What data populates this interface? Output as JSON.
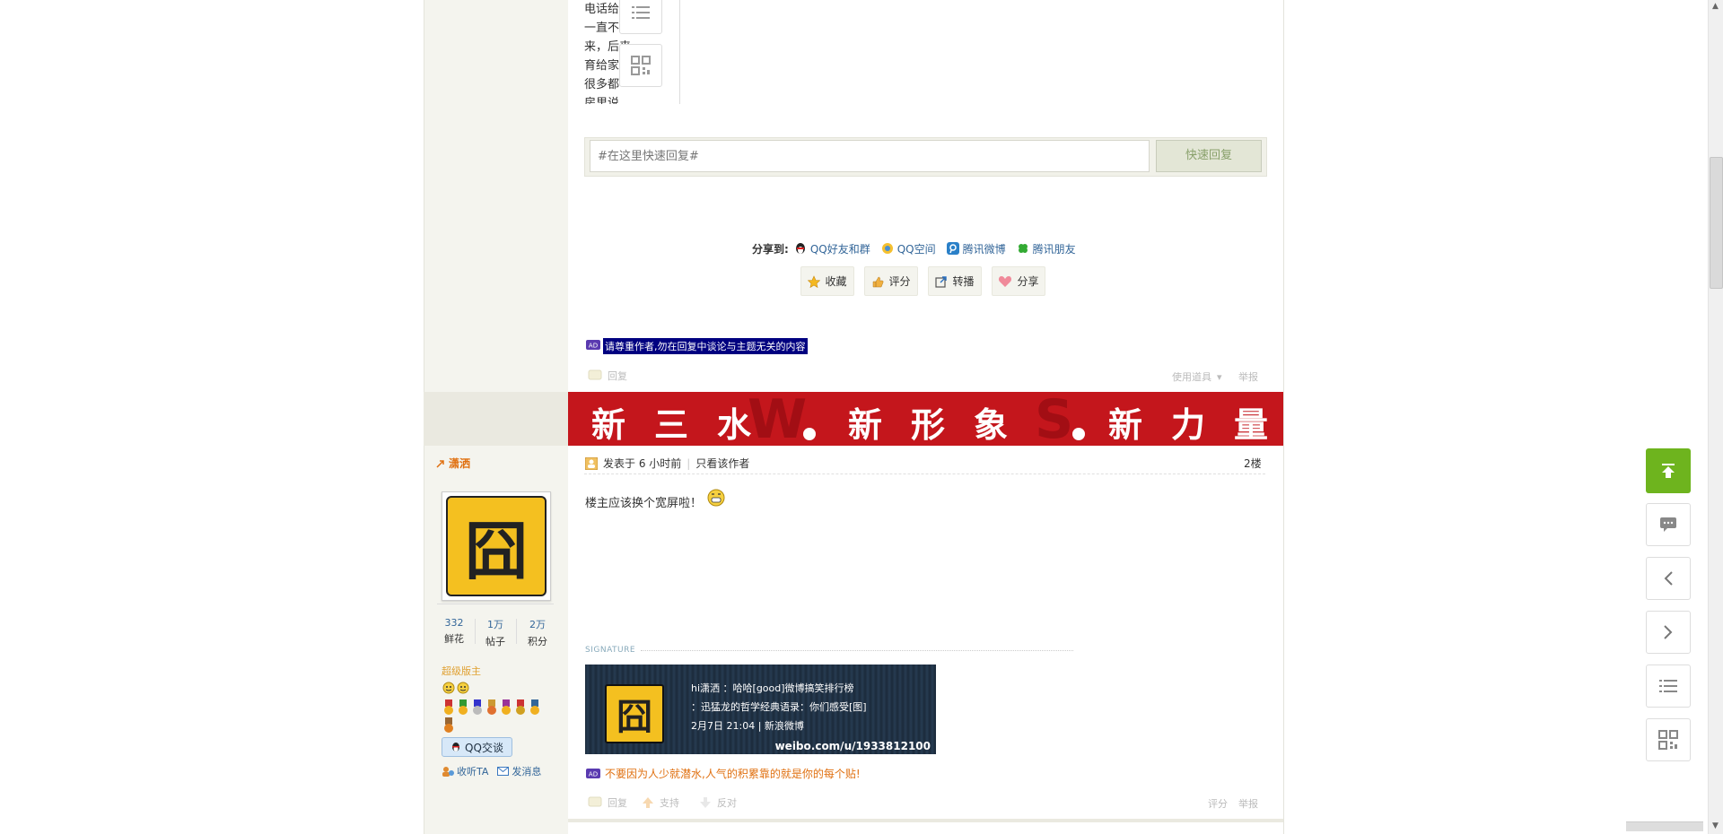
{
  "partial_post": {
    "lines": [
      "电话给",
      "一直不",
      "来，后来",
      "育给家",
      "很多都",
      "房里说，"
    ]
  },
  "quick_reply": {
    "placeholder": "#在这里快速回复#",
    "button": "快速回复"
  },
  "share": {
    "label": "分享到:",
    "targets": [
      "QQ好友和群",
      "QQ空间",
      "腾讯微博",
      "腾讯朋友"
    ]
  },
  "actions": {
    "favorite": "收藏",
    "rate": "评分",
    "repost": "转播",
    "share": "分享"
  },
  "post1": {
    "notice": "请尊重作者,勿在回复中谈论与主题无关的内容",
    "reply": "回复",
    "use_tool": "使用道具",
    "report": "举报"
  },
  "banner": {
    "text": "新三水.新形象.新力量",
    "ghost": "SWS"
  },
  "user": {
    "name": "潇洒",
    "avatar_char": "囧",
    "stats": [
      {
        "value": "332",
        "label": "鲜花"
      },
      {
        "value": "1万",
        "label": "帖子"
      },
      {
        "value": "2万",
        "label": "积分"
      }
    ],
    "role": "超级版主",
    "qq_talk": "QQ交谈",
    "follow": "收听TA",
    "message": "发消息"
  },
  "post2": {
    "posted": "发表于 6 小时前",
    "only_author": "只看该作者",
    "floor": "2楼",
    "content": "楼主应该换个宽屏啦！",
    "signature_label": "SIGNATURE",
    "sig_card": {
      "line1": "hi潇洒 ：哈哈[good]微博搞笑排行榜",
      "line2": "：迅猛龙的哲学经典语录：你们感受[图]",
      "line3": "2月7日 21:04 | 新浪微博",
      "url": "weibo.com/u/1933812100"
    },
    "notice": "不要因为人少就潜水,人气的积累靠的就是你的每个贴!",
    "reply": "回复",
    "support": "支持",
    "oppose": "反对",
    "rate": "评分",
    "report": "举报"
  },
  "colors": {
    "banner_red": "#c4161c",
    "accent_green": "#6eb41e",
    "link_blue": "#336699",
    "name_orange": "#e07010"
  }
}
